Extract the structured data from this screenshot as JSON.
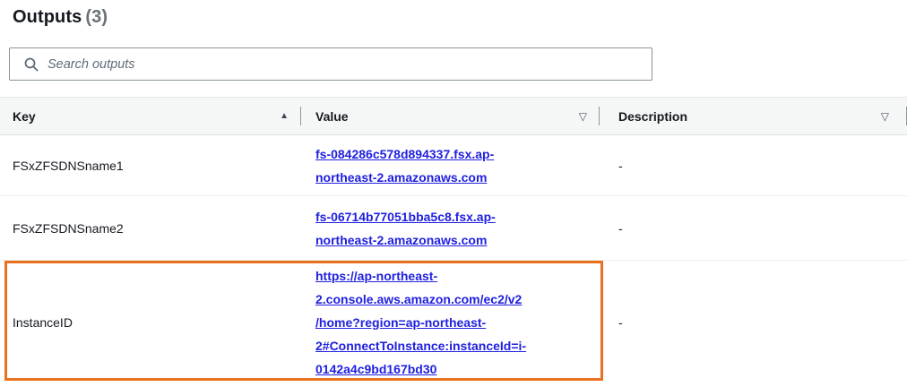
{
  "header": {
    "title": "Outputs",
    "count": "(3)"
  },
  "search": {
    "placeholder": "Search outputs"
  },
  "table": {
    "columns": [
      {
        "label": "Key",
        "sort_state": "ascending",
        "sort_icon": "▲"
      },
      {
        "label": "Value",
        "sort_state": "unsorted",
        "sort_icon": "▽"
      },
      {
        "label": "Description",
        "sort_state": "unsorted",
        "sort_icon": "▽"
      }
    ],
    "rows": [
      {
        "key": "FSxZFSDNSname1",
        "value": "fs-084286c578d894337.fsx.ap-\nnortheast-2.amazonaws.com",
        "description": "-"
      },
      {
        "key": "FSxZFSDNSname2",
        "value": "fs-06714b77051bba5c8.fsx.ap-\nnortheast-2.amazonaws.com",
        "description": "-"
      },
      {
        "key": "InstanceID",
        "value": "https://ap-northeast-\n2.console.aws.amazon.com/ec2/v2\n/home?region=ap-northeast-\n2#ConnectToInstance:instanceId=i-\n0142a4c9bd167bd30",
        "description": "-"
      }
    ]
  },
  "annotation": {
    "type": "highlight-rectangle",
    "target_row_key": "InstanceID"
  },
  "colors": {
    "highlight_orange": "#e8711f",
    "link_blue": "#2020e0",
    "text_dark": "#16191f",
    "count_gray": "#687078",
    "header_bg": "#f5f6f6"
  },
  "icons": {
    "search": "magnifier-icon",
    "sort_ascending": "▲",
    "sort_none": "▽"
  }
}
